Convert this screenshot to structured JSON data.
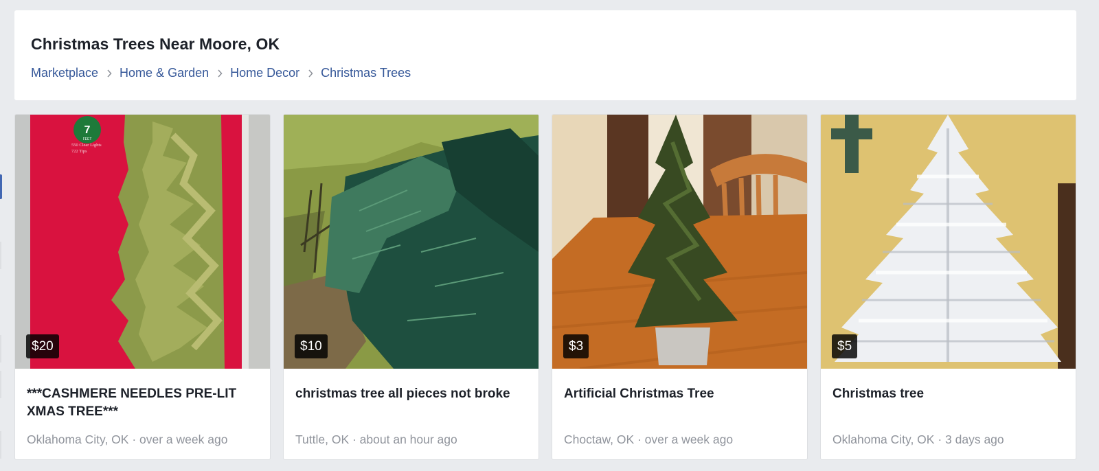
{
  "page": {
    "title": "Christmas Trees Near Moore, OK"
  },
  "breadcrumb": [
    {
      "label": "Marketplace"
    },
    {
      "label": "Home & Garden"
    },
    {
      "label": "Home Decor"
    },
    {
      "label": "Christmas Trees"
    }
  ],
  "listings": [
    {
      "price": "$20",
      "title": "***CASHMERE NEEDLES PRE-LIT XMAS TREE***",
      "location": "Oklahoma City, OK",
      "time": "over a week ago",
      "meta": "Oklahoma City, OK · over a week ago",
      "box_label_number": "7",
      "box_label_unit": "FEET",
      "box_label_line1": "550 Clear Lights",
      "box_label_line2": "722 Tips"
    },
    {
      "price": "$10",
      "title": "christmas tree all pieces not broke",
      "location": "Tuttle, OK",
      "time": "about an hour ago",
      "meta": "Tuttle, OK · about an hour ago"
    },
    {
      "price": "$3",
      "title": "Artificial Christmas Tree",
      "location": "Choctaw, OK",
      "time": "over a week ago",
      "meta": "Choctaw, OK · over a week ago"
    },
    {
      "price": "$5",
      "title": "Christmas tree",
      "location": "Oklahoma City, OK",
      "time": "3 days ago",
      "meta": "Oklahoma City, OK · 3 days ago"
    }
  ],
  "icons": {
    "breadcrumb_separator": "chevron-right-icon"
  },
  "colors": {
    "link": "#365899",
    "title_text": "#1d2129",
    "meta_text": "#90949c",
    "page_background": "#e9ebee",
    "price_badge_bg": "#000000"
  }
}
